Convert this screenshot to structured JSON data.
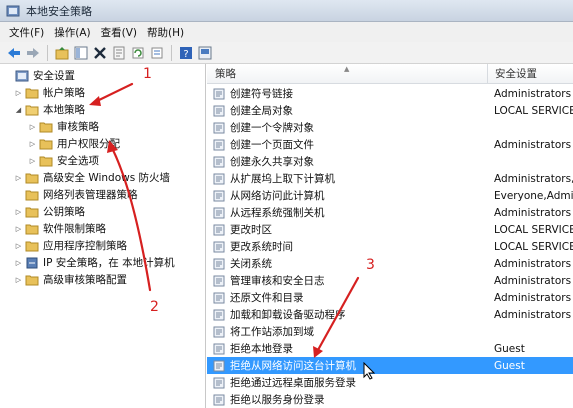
{
  "window": {
    "title": "本地安全策略"
  },
  "menu": [
    "文件(F)",
    "操作(A)",
    "查看(V)",
    "帮助(H)"
  ],
  "toolbar": [
    "back-icon",
    "forward-icon",
    "up-icon",
    "show-hide-icon",
    "delete-icon",
    "properties-icon",
    "refresh-icon",
    "export-icon",
    "help-icon",
    "console-icon"
  ],
  "tree": [
    {
      "label": "安全设置",
      "level": 0,
      "twisty": ""
    },
    {
      "label": "帐户策略",
      "level": 1,
      "twisty": "▷"
    },
    {
      "label": "本地策略",
      "level": 1,
      "twisty": "◢"
    },
    {
      "label": "审核策略",
      "level": 2,
      "twisty": "▷"
    },
    {
      "label": "用户权限分配",
      "level": 2,
      "twisty": "▷"
    },
    {
      "label": "安全选项",
      "level": 2,
      "twisty": "▷"
    },
    {
      "label": "高级安全 Windows 防火墙",
      "level": 1,
      "twisty": "▷"
    },
    {
      "label": "网络列表管理器策略",
      "level": 1,
      "twisty": ""
    },
    {
      "label": "公钥策略",
      "level": 1,
      "twisty": "▷"
    },
    {
      "label": "软件限制策略",
      "level": 1,
      "twisty": "▷"
    },
    {
      "label": "应用程序控制策略",
      "level": 1,
      "twisty": "▷"
    },
    {
      "label": "IP 安全策略，在 本地计算机",
      "level": 1,
      "twisty": "▷"
    },
    {
      "label": "高级审核策略配置",
      "level": 1,
      "twisty": "▷"
    }
  ],
  "columns": {
    "policy": "策略",
    "setting": "安全设置"
  },
  "rows": [
    {
      "policy": "创建符号链接",
      "setting": "Administrators"
    },
    {
      "policy": "创建全局对象",
      "setting": "LOCAL SERVICE"
    },
    {
      "policy": "创建一个令牌对象",
      "setting": ""
    },
    {
      "policy": "创建一个页面文件",
      "setting": "Administrators"
    },
    {
      "policy": "创建永久共享对象",
      "setting": ""
    },
    {
      "policy": "从扩展坞上取下计算机",
      "setting": "Administrators,U"
    },
    {
      "policy": "从网络访问此计算机",
      "setting": "Everyone,Admin"
    },
    {
      "policy": "从远程系统强制关机",
      "setting": "Administrators"
    },
    {
      "policy": "更改时区",
      "setting": "LOCAL SERVICE"
    },
    {
      "policy": "更改系统时间",
      "setting": "LOCAL SERVICE"
    },
    {
      "policy": "关闭系统",
      "setting": "Administrators"
    },
    {
      "policy": "管理审核和安全日志",
      "setting": "Administrators"
    },
    {
      "policy": "还原文件和目录",
      "setting": "Administrators"
    },
    {
      "policy": "加载和卸载设备驱动程序",
      "setting": "Administrators"
    },
    {
      "policy": "将工作站添加到域",
      "setting": ""
    },
    {
      "policy": "拒绝本地登录",
      "setting": "Guest"
    },
    {
      "policy": "拒绝从网络访问这台计算机",
      "setting": "Guest",
      "selected": true
    },
    {
      "policy": "拒绝通过远程桌面服务登录",
      "setting": ""
    },
    {
      "policy": "拒绝以服务身份登录",
      "setting": ""
    }
  ],
  "annotations": [
    "1",
    "2",
    "3"
  ],
  "colors": {
    "annotation": "#d62020",
    "selection": "#3399ff",
    "folder": "#e8c15a"
  }
}
